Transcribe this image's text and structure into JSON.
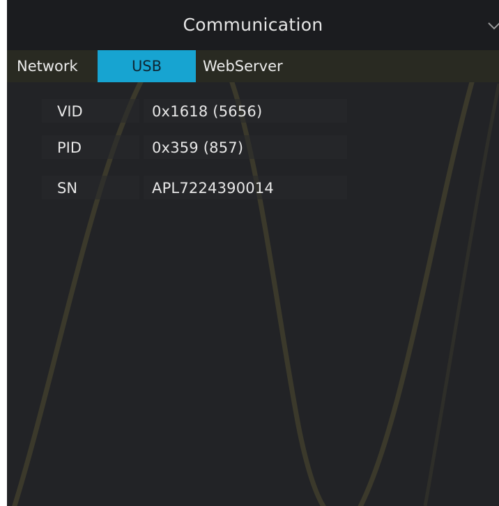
{
  "header": {
    "title": "Communication"
  },
  "tabs": [
    {
      "label": "Network",
      "active": false
    },
    {
      "label": "USB",
      "active": true
    },
    {
      "label": "WebServer",
      "active": false
    }
  ],
  "usb_info": [
    {
      "label": "VID",
      "value": "0x1618 (5656)"
    },
    {
      "label": "PID",
      "value": "0x359 (857)"
    },
    {
      "label": "SN",
      "value": "APL7224390014"
    }
  ],
  "icons": {
    "collapse": "chevron-down-icon"
  },
  "colors": {
    "panel_background": "#222326",
    "header_background": "#1b1c1f",
    "tabbar_background": "#292a22",
    "active_tab": "#17a4d1",
    "text": "#e8e8e8",
    "waveform_trace": "#6b6436"
  }
}
